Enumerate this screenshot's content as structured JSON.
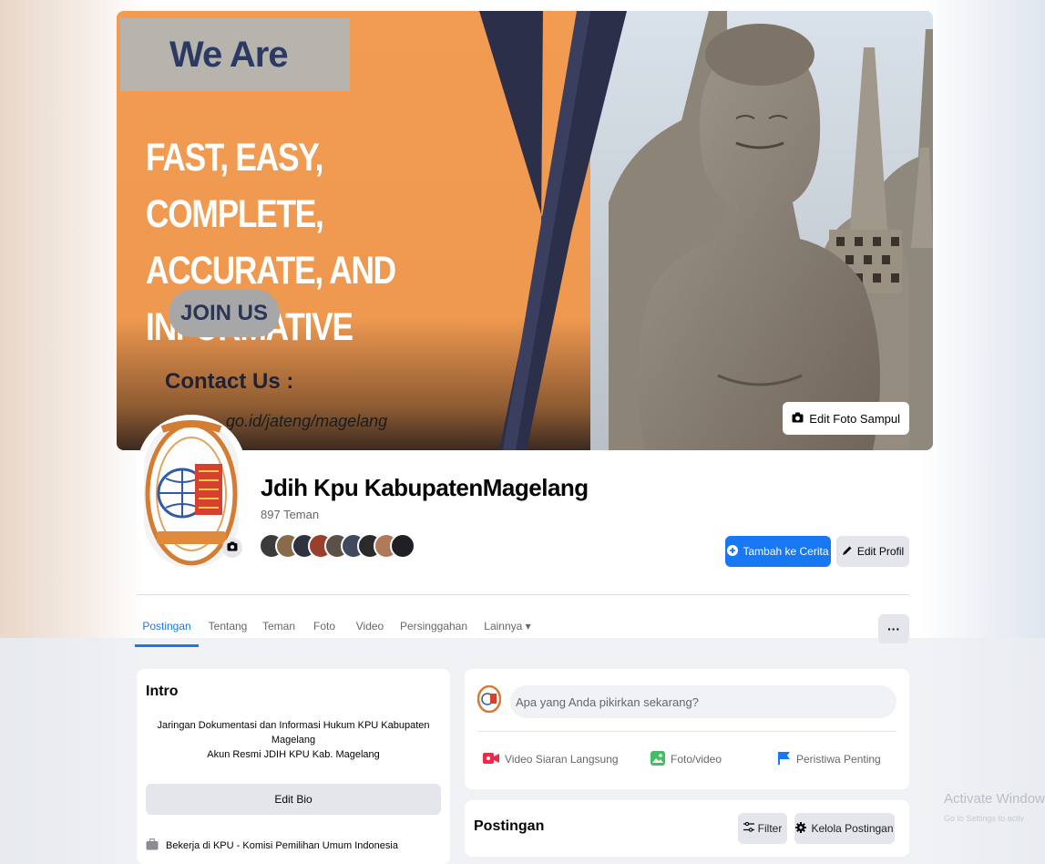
{
  "cover": {
    "headline": "We Are",
    "tagline_line1": "FAST, EASY, COMPLETE,",
    "tagline_line2": "ACCURATE, AND INFORMATIVE",
    "join_label": "JOIN US",
    "contact_label": "Contact Us :",
    "contact_url": "go.id/jateng/magelang",
    "edit_cover_label": "Edit Foto Sampul",
    "accent_color": "#ef9a52",
    "stripe_color": "#2c2f4a"
  },
  "profile": {
    "name": "Jdih Kpu KabupatenMagelang",
    "friends_count": "897 Teman",
    "add_story_label": "Tambah ke Cerita",
    "edit_profile_label": "Edit Profil",
    "friend_avatar_count": 9
  },
  "tabs": [
    {
      "label": "Postingan",
      "active": true
    },
    {
      "label": "Tentang",
      "active": false
    },
    {
      "label": "Teman",
      "active": false
    },
    {
      "label": "Foto",
      "active": false
    },
    {
      "label": "Video",
      "active": false
    },
    {
      "label": "Persinggahan",
      "active": false
    },
    {
      "label": "Lainnya ▾",
      "active": false
    }
  ],
  "more_label": "···",
  "intro": {
    "title": "Intro",
    "bio_lines": [
      "Jaringan Dokumentasi dan Informasi Hukum KPU Kabupaten",
      "Magelang",
      "Akun Resmi JDIH KPU Kab. Magelang"
    ],
    "edit_bio_label": "Edit Bio",
    "work": "Bekerja di KPU - Komisi Pemilihan Umum Indonesia"
  },
  "composer": {
    "placeholder": "Apa yang Anda pikirkan sekarang?",
    "actions": [
      {
        "label": "Video Siaran Langsung",
        "icon": "live-video-icon",
        "color": "#f02849"
      },
      {
        "label": "Foto/video",
        "icon": "photo-icon",
        "color": "#45bd62"
      },
      {
        "label": "Peristiwa Penting",
        "icon": "flag-icon",
        "color": "#1877f2"
      }
    ]
  },
  "posts": {
    "title": "Postingan",
    "filter_label": "Filter",
    "manage_label": "Kelola Postingan"
  },
  "watermark": {
    "title": "Activate Window",
    "subtitle": "Go to Settings to activ"
  }
}
